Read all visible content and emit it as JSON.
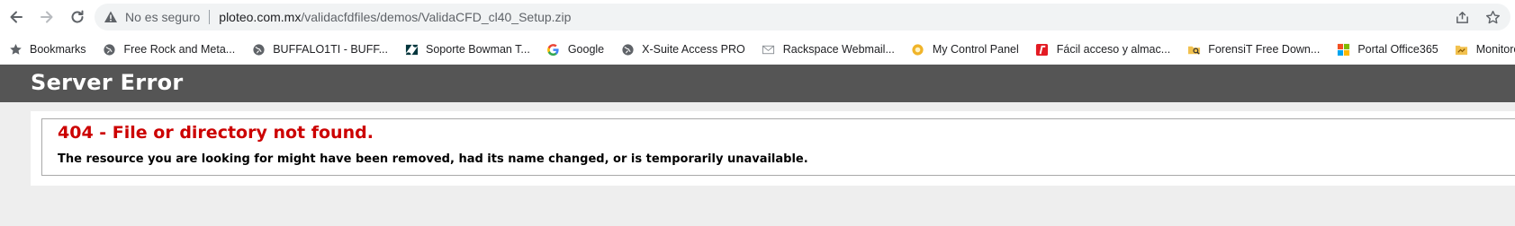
{
  "browser": {
    "security_text": "No es seguro",
    "url_host": "ploteo.com.mx",
    "url_path": "/validacfdfiles/demos/ValidaCFD_cl40_Setup.zip"
  },
  "bookmarks": [
    {
      "label": "Bookmarks",
      "icon": "star-icon"
    },
    {
      "label": "Free Rock and Meta...",
      "icon": "globe-icon"
    },
    {
      "label": "BUFFALO1TI - BUFF...",
      "icon": "globe-icon"
    },
    {
      "label": "Soporte Bowman T...",
      "icon": "zendesk-icon"
    },
    {
      "label": "Google",
      "icon": "google-icon"
    },
    {
      "label": "X-Suite Access PRO",
      "icon": "globe-icon"
    },
    {
      "label": "Rackspace Webmail...",
      "icon": "mail-icon"
    },
    {
      "label": "My Control Panel",
      "icon": "control-panel-icon"
    },
    {
      "label": "Fácil acceso y almac...",
      "icon": "red-r-icon"
    },
    {
      "label": "ForensiT Free Down...",
      "icon": "forensit-icon"
    },
    {
      "label": "Portal Office365",
      "icon": "office365-icon"
    },
    {
      "label": "Monitoreo de Enlac...",
      "icon": "monitor-folder-icon"
    }
  ],
  "page": {
    "header_title": "Server Error",
    "error_title": "404 - File or directory not found.",
    "error_message": "The resource you are looking for might have been removed, had its name changed, or is temporarily unavailable."
  },
  "colors": {
    "header_bg": "#555555",
    "error_red": "#cc0000",
    "page_bg": "#eeeeee"
  }
}
